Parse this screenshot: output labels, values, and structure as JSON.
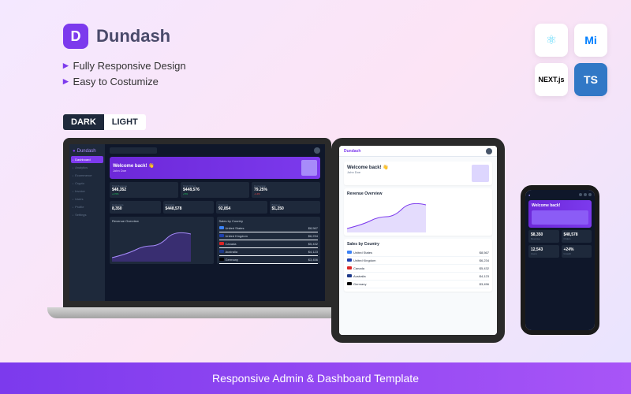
{
  "brand": {
    "initial": "D",
    "name": "Dundash"
  },
  "features": [
    "Fully Responsive Design",
    "Easy to Costumize"
  ],
  "modes": {
    "dark": "DARK",
    "light": "LIGHT"
  },
  "tech": {
    "react": "⚛",
    "mui": "Mi",
    "next": "NEXT.js",
    "ts": "TS"
  },
  "footer": "Responsive Admin & Dashboard Template",
  "dashboard": {
    "logo": "Dundash",
    "nav": [
      "Dashboard",
      "Analytics",
      "Ecommerce",
      "Crypto",
      "Invoice",
      "Users",
      "Profile",
      "Settings"
    ],
    "welcome": {
      "title": "Welcome back!",
      "emoji": "👋",
      "user": "John Doe"
    },
    "stats": [
      {
        "label": "Total Revenue",
        "value": "$48,352",
        "change": "+2.5%"
      },
      {
        "label": "Total Orders",
        "value": "$448,576",
        "change": "+5%"
      },
      {
        "label": "Conversion",
        "value": "79.25%",
        "change": "-1.2%"
      }
    ],
    "stats2": [
      {
        "label": "Customers",
        "value": "8,350",
        "change": "+12%"
      },
      {
        "label": "Products",
        "value": "$448,578",
        "change": "+3%"
      },
      {
        "label": "Sessions",
        "value": "92,854",
        "change": "+8%"
      },
      {
        "label": "Balance",
        "value": "$1,250",
        "change": "+2%"
      }
    ],
    "chart_titles": {
      "revenue": "Revenue Overview",
      "sales": "Sales by Country"
    },
    "countries": [
      {
        "name": "United States",
        "value": "$8,567",
        "flag": "#3b82f6"
      },
      {
        "name": "United Kingdom",
        "value": "$6,234",
        "flag": "#1e40af"
      },
      {
        "name": "Canada",
        "value": "$5,432",
        "flag": "#dc2626"
      },
      {
        "name": "Australia",
        "value": "$4,123",
        "flag": "#1e3a8a"
      },
      {
        "name": "Germany",
        "value": "$3,456",
        "flag": "#000"
      }
    ]
  },
  "phone": {
    "welcome": "Welcome back!",
    "stats": [
      {
        "label": "Revenue",
        "value": "$8,350"
      },
      {
        "label": "Orders",
        "value": "$48,578"
      },
      {
        "label": "Users",
        "value": "12,543"
      },
      {
        "label": "Growth",
        "value": "+24%"
      }
    ]
  }
}
